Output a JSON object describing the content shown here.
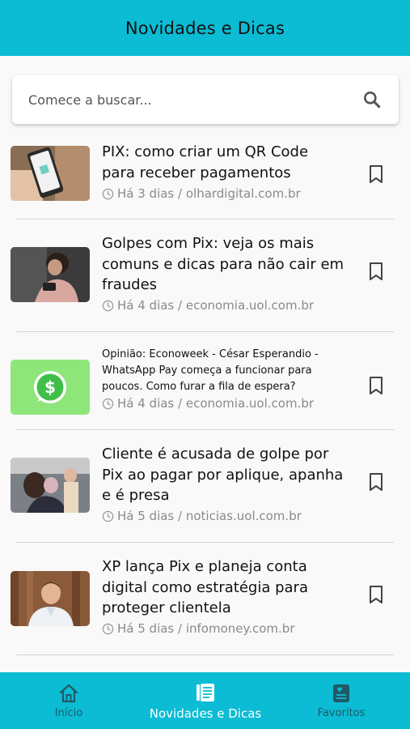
{
  "header": {
    "title": "Novidades e Dicas"
  },
  "search": {
    "placeholder": "Comece a buscar..."
  },
  "articles": [
    {
      "title": "PIX: como criar um QR Code para receber pagamentos",
      "age": "Há 3 dias",
      "separator": " / ",
      "source": "olhardigital.com.br",
      "thumb": "phone-qr-photo"
    },
    {
      "title": "Golpes com Pix: veja os mais comuns e dicas para não cair em fraudes",
      "age": "Há 4 dias",
      "separator": " / ",
      "source": "economia.uol.com.br",
      "thumb": "worried-woman-photo"
    },
    {
      "title": "Opinião: Econoweek - César Esperandio - WhatsApp Pay começa a funcionar para poucos. Como furar a fila de espera?",
      "age": "Há 4 dias",
      "separator": " / ",
      "source": "economia.uol.com.br",
      "thumb": "whatsapp-pay-logo"
    },
    {
      "title": "Cliente é acusada de golpe por Pix ao pagar por aplique, apanha e é presa",
      "age": "Há 5 dias",
      "separator": " / ",
      "source": "noticias.uol.com.br",
      "thumb": "salon-photo"
    },
    {
      "title": "XP lança Pix e planeja conta digital como estratégia para proteger clientela",
      "age": "Há 5 dias",
      "separator": " / ",
      "source": "infomoney.com.br",
      "thumb": "man-portrait-photo"
    }
  ],
  "tabs": [
    {
      "label": "Início",
      "icon": "home-icon",
      "active": false
    },
    {
      "label": "Novidades e Dicas",
      "icon": "news-icon",
      "active": true
    },
    {
      "label": "Favoritos",
      "icon": "favorites-icon",
      "active": false
    }
  ],
  "colors": {
    "accent": "#0bbcd4",
    "active_tab_text": "#ffffff",
    "inactive_tab_text": "#1f5a66",
    "meta_text": "#8a8a8a"
  }
}
